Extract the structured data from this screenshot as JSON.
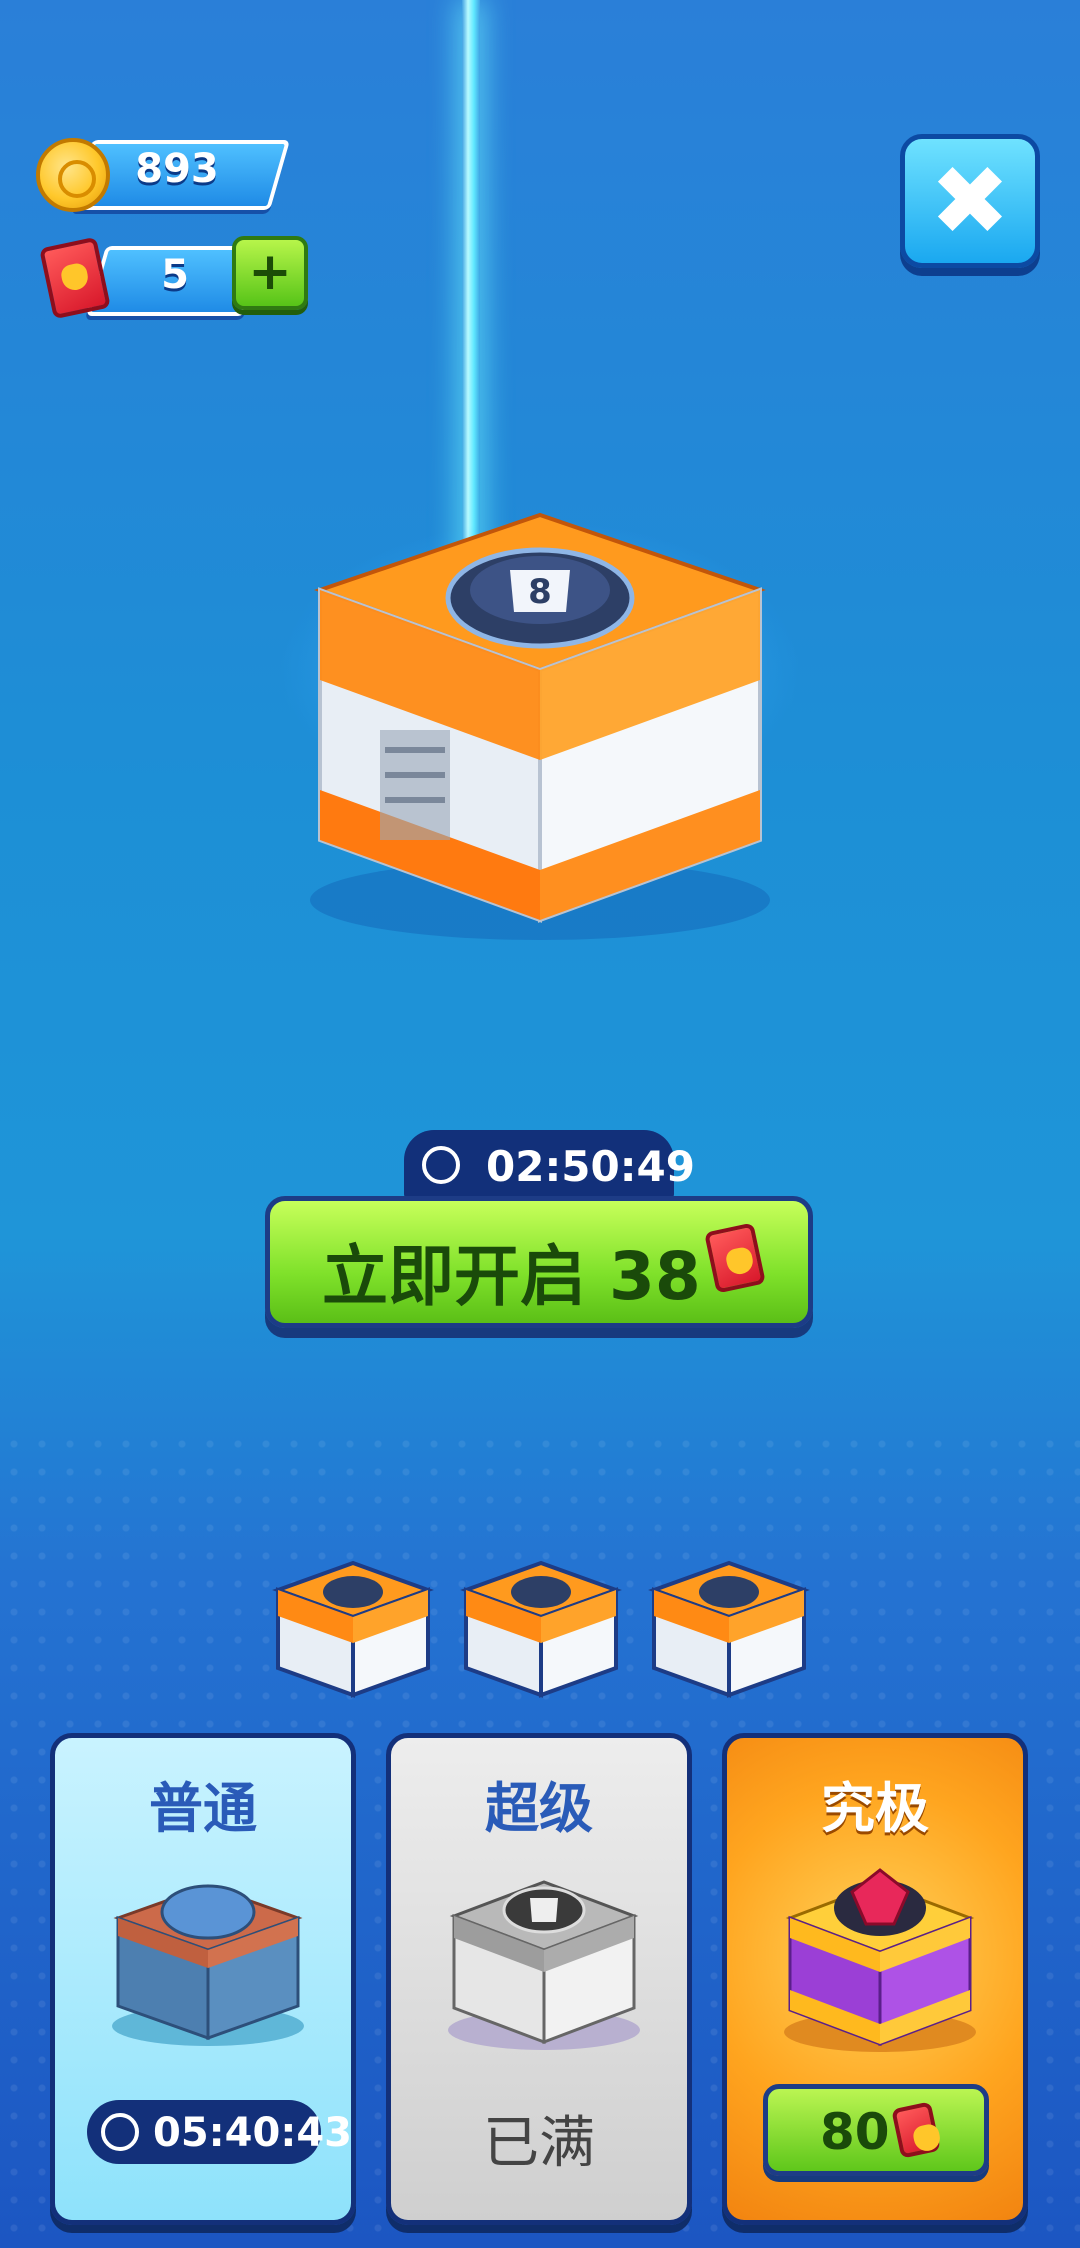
{
  "hud": {
    "coins": "893",
    "cards": "5",
    "plus_label": "+"
  },
  "close_label": "✖",
  "open_section": {
    "timer": "02:50:49",
    "open_label": "立即开启",
    "open_cost": "38"
  },
  "chest_modes": [
    {
      "title": "普通",
      "timer": "05:40:43"
    },
    {
      "title": "超级",
      "status": "已满"
    },
    {
      "title": "究极",
      "cost": "80"
    }
  ],
  "colors": {
    "button_green": "#7fe12a",
    "navy_outline": "#13307a",
    "beam": "#5fe8ff"
  }
}
